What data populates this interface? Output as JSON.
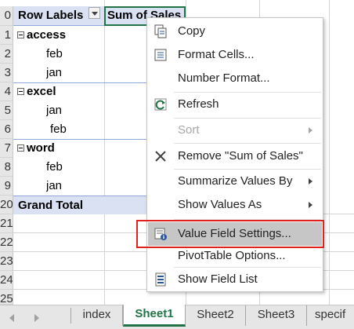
{
  "sheet": {
    "row_numbers": [
      "0",
      "1",
      "2",
      "3",
      "4",
      "5",
      "6",
      "7",
      "8",
      "9",
      "20",
      "21",
      "22",
      "23",
      "24",
      "25"
    ],
    "header": {
      "row_labels": "Row Labels",
      "sum_of_sales": "Sum of Sales"
    },
    "rows": [
      {
        "label": "access",
        "level": 0
      },
      {
        "label": "feb",
        "level": 1
      },
      {
        "label": "jan",
        "level": 1
      },
      {
        "label": "excel",
        "level": 0
      },
      {
        "label": "jan",
        "level": 1
      },
      {
        "label": "feb",
        "level": 1
      },
      {
        "label": "word",
        "level": 0
      },
      {
        "label": "feb",
        "level": 1
      },
      {
        "label": "jan",
        "level": 1
      }
    ],
    "grand_total": "Grand Total"
  },
  "context_menu": {
    "items": [
      {
        "label": "Copy",
        "icon": "copy-icon"
      },
      {
        "label": "Format Cells...",
        "icon": "format-cells-icon"
      },
      {
        "label": "Number Format..."
      },
      {
        "label": "Refresh",
        "icon": "refresh-icon"
      },
      {
        "label": "Sort",
        "disabled": true,
        "submenu": true
      },
      {
        "label": "Remove \"Sum of Sales\"",
        "icon": "remove-x-icon"
      },
      {
        "label": "Summarize Values By",
        "submenu": true
      },
      {
        "label": "Show Values As",
        "submenu": true
      },
      {
        "label": "Value Field Settings...",
        "icon": "value-field-settings-icon",
        "highlighted": true
      },
      {
        "label": "PivotTable Options..."
      },
      {
        "label": "Show Field List",
        "icon": "field-list-icon"
      }
    ]
  },
  "tabs": {
    "items": [
      "index",
      "Sheet1",
      "Sheet2",
      "Sheet3",
      "specif"
    ],
    "active": "Sheet1"
  },
  "colors": {
    "accent_green": "#217346",
    "pivot_header_blue": "#d9e1f2",
    "highlight_outline_red": "#e0211d",
    "menu_highlight_gray": "#c6c6c6"
  }
}
